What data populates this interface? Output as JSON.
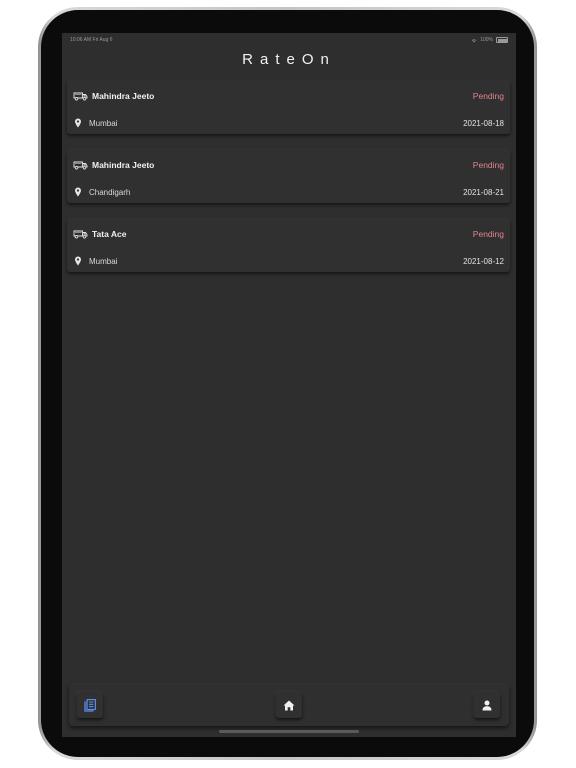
{
  "status_bar": {
    "time": "10:06 AM",
    "date": "Fri Aug 6",
    "battery": "100%"
  },
  "app": {
    "title": "RateOn"
  },
  "requests": [
    {
      "vehicle": "Mahindra Jeeto",
      "status": "Pending",
      "location": "Mumbai",
      "date": "2021-08-18"
    },
    {
      "vehicle": "Mahindra Jeeto",
      "status": "Pending",
      "location": "Chandigarh",
      "date": "2021-08-21"
    },
    {
      "vehicle": "Tata Ace",
      "status": "Pending",
      "location": "Mumbai",
      "date": "2021-08-12"
    }
  ],
  "bottom_nav": {
    "items": [
      {
        "icon": "list-icon",
        "active": true
      },
      {
        "icon": "home-icon",
        "active": false
      },
      {
        "icon": "person-icon",
        "active": false
      }
    ]
  },
  "colors": {
    "background": "#2e2e2e",
    "card": "#303030",
    "pending": "#e0848c",
    "active_nav": "#5b8def"
  }
}
